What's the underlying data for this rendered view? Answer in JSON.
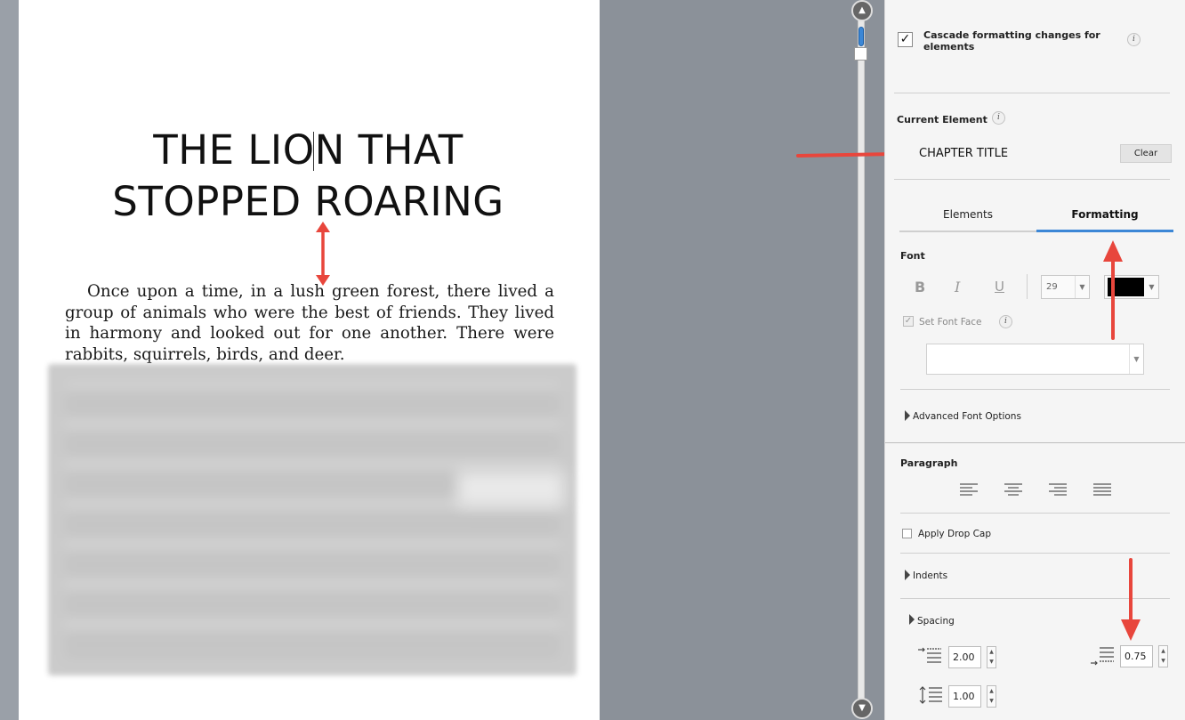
{
  "document": {
    "title_line1": "THE LION THAT",
    "title_line2": "STOPPED ROARING",
    "paragraph": "Once upon a time, in a lush green forest, there lived a group of animals who were the best of friends. They lived in harmony and looked out for one another. There were rabbits, squirrels, birds, and deer."
  },
  "panel": {
    "cascade_label": "Cascade formatting changes for elements",
    "cascade_checked": true,
    "current_element_label": "Current Element",
    "current_element_value": "CHAPTER TITLE",
    "clear_label": "Clear",
    "tabs": [
      {
        "label": "Elements",
        "active": false
      },
      {
        "label": "Formatting",
        "active": true
      }
    ],
    "font_section": "Font",
    "bold_label": "B",
    "italic_label": "I",
    "underline_label": "U",
    "font_size": "29",
    "font_color": "#000000",
    "set_font_face_label": "Set Font Face",
    "font_face_value": "",
    "advanced_font_label": "Advanced Font Options",
    "paragraph_section": "Paragraph",
    "drop_cap_label": "Apply Drop Cap",
    "indents_label": "Indents",
    "spacing_label": "Spacing",
    "space_before": "2.00",
    "space_after": "0.75",
    "line_spacing": "1.00",
    "info_glyph": "i"
  },
  "colors": {
    "accent": "#3c87d6",
    "annotation_arrow": "#e8463c"
  },
  "icons": [
    "scroll-up-icon",
    "scroll-down-icon",
    "info-icon",
    "checkmark-icon",
    "dropdown-icon",
    "align-left-icon",
    "align-center-icon",
    "align-right-icon",
    "justify-icon",
    "expand-triangle-icon",
    "space-before-icon",
    "space-after-icon",
    "line-spacing-icon",
    "annotation-arrow-icon"
  ]
}
